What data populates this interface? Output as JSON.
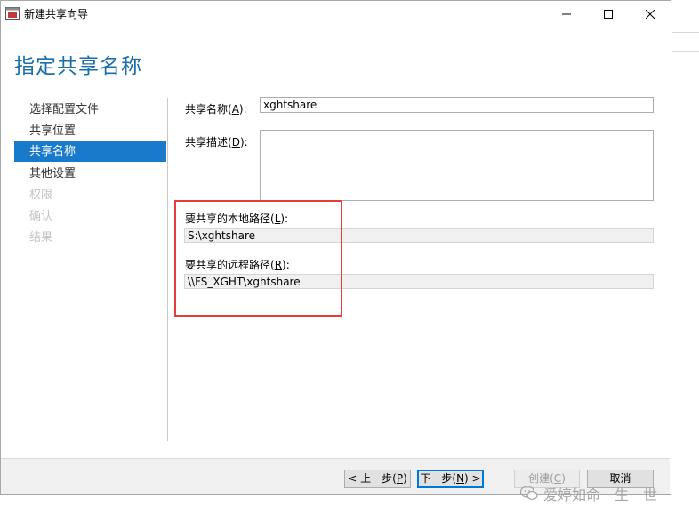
{
  "window": {
    "title": "新建共享向导",
    "controls": {
      "minimize_icon": "minimize-icon",
      "maximize_icon": "maximize-icon",
      "close_icon": "close-icon"
    }
  },
  "page_title": "指定共享名称",
  "nav": {
    "items": [
      {
        "label": "选择配置文件",
        "state": "normal"
      },
      {
        "label": "共享位置",
        "state": "normal"
      },
      {
        "label": "共享名称",
        "state": "active"
      },
      {
        "label": "其他设置",
        "state": "normal"
      },
      {
        "label": "权限",
        "state": "disabled"
      },
      {
        "label": "确认",
        "state": "disabled"
      },
      {
        "label": "结果",
        "state": "disabled"
      }
    ]
  },
  "form": {
    "share_name": {
      "label_prefix": "共享名称(",
      "hotkey": "A",
      "label_suffix": "):",
      "value": "xghtshare"
    },
    "share_desc": {
      "label_prefix": "共享描述(",
      "hotkey": "D",
      "label_suffix": "):",
      "value": ""
    },
    "local_path": {
      "label_prefix": "要共享的本地路径(",
      "hotkey": "L",
      "label_suffix": "):",
      "value": "S:\\xghtshare"
    },
    "remote_path": {
      "label_prefix": "要共享的远程路径(",
      "hotkey": "R",
      "label_suffix": "):",
      "value": "\\\\FS_XGHT\\xghtshare"
    }
  },
  "buttons": {
    "prev": {
      "prefix": "< 上一步(",
      "hotkey": "P",
      "suffix": ")"
    },
    "next": {
      "prefix": "下一步(",
      "hotkey": "N",
      "suffix": ") >"
    },
    "create": {
      "prefix": "创建(",
      "hotkey": "C",
      "suffix": ")"
    },
    "cancel": {
      "label": "取消"
    }
  },
  "watermark": {
    "text": "爱婷如命一生一世",
    "icon": "wechat-icon"
  },
  "colors": {
    "accent": "#1979ca",
    "title_blue": "#1a6fa8",
    "highlight_red": "#e53c3c"
  }
}
